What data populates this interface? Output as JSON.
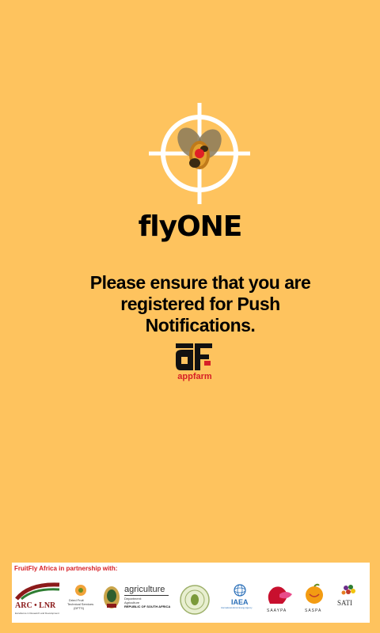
{
  "app": {
    "title": "flyONE",
    "notice": "Please ensure that you are registered for Push Notifications."
  },
  "branding": {
    "appfarm_text": "appfarm"
  },
  "partners": {
    "heading": "FruitFly Africa in partnership with:",
    "arc": {
      "name": "ARC • LNR",
      "tagline": "Excellence in Research and Development"
    },
    "dfts": {
      "line1": "Dried Fruit",
      "line2": "Technical Services",
      "line3": "(DFTS)"
    },
    "agriculture": {
      "title": "agriculture",
      "line1": "Department:",
      "line2": "Agriculture",
      "line3": "REPUBLIC OF SOUTH AFRICA"
    },
    "iaea": {
      "name": "IAEA",
      "tagline": "International Atomic Energy Agency"
    },
    "saaypa": {
      "name": "SAAYPA"
    },
    "sasa": {
      "name": "SASPA"
    },
    "sati": {
      "name": "SATI"
    }
  },
  "colors": {
    "background": "#fec35e",
    "accent_red": "#d62027"
  }
}
